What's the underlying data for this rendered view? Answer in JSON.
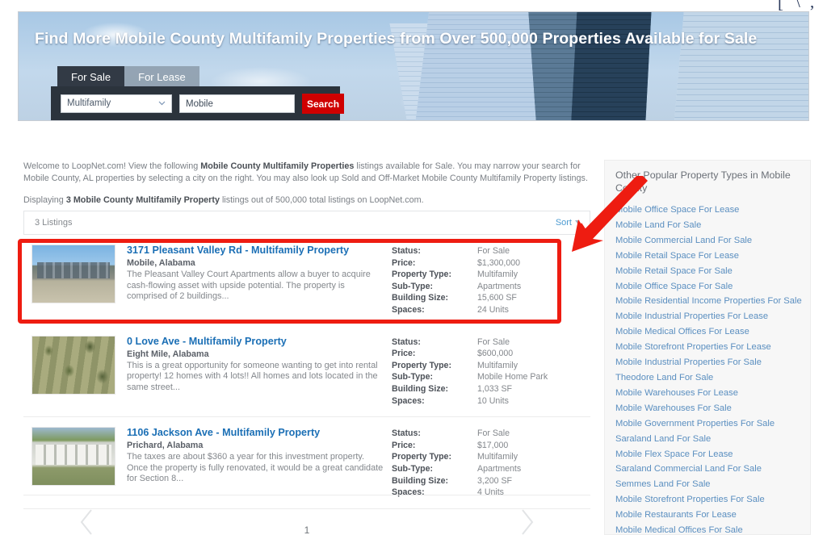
{
  "top_partial_glyphs": [
    "[",
    "\\",
    ",",
    ")"
  ],
  "hero": {
    "title": "Find More Mobile County Multifamily Properties from Over 500,000 Properties Available for Sale",
    "tabs": [
      {
        "label": "For Sale",
        "active": true
      },
      {
        "label": "For Lease",
        "active": false
      }
    ],
    "search": {
      "property_type_value": "Multifamily",
      "location_value": "Mobile",
      "location_placeholder": "Mobile",
      "button_label": "Search",
      "chevron_icon": "chevron-down-icon",
      "accent_color": "#cf0000"
    }
  },
  "intro": {
    "line1_a": "Welcome to LoopNet.com! View the following ",
    "line1_b": "Mobile County Multifamily Properties",
    "line1_c": " listings available for Sale. You may narrow your search for Mobile County, AL properties by selecting a city on the right. You may also look up Sold and Off-Market Mobile County Multifamily Property listings.",
    "line2_a": "Displaying ",
    "line2_b": "3 Mobile County Multifamily Property",
    "line2_c": " listings out of 500,000 total listings on LoopNet.com."
  },
  "listings_header": {
    "count_label": "3 Listings",
    "sort_label": "Sort",
    "sort_icon": "caret-down-icon"
  },
  "spec_labels": [
    "Status:",
    "Price:",
    "Property Type:",
    "Sub-Type:",
    "Building Size:",
    "Spaces:"
  ],
  "listings": [
    {
      "title": "3171 Pleasant Valley Rd - Multifamily Property",
      "city": "Mobile, Alabama",
      "description": "The Pleasant Valley Court Apartments allow a buyer to acquire cash-flowing asset with upside potential. The property is comprised of 2 buildings...",
      "thumb_icon": "apartment-building-photo",
      "specs": {
        "status": "For Sale",
        "price": "$1,300,000",
        "property_type": "Multifamily",
        "sub_type": "Apartments",
        "building_size": "15,600 SF",
        "spaces": "24 Units"
      },
      "highlighted": true
    },
    {
      "title": "0 Love Ave - Multifamily Property",
      "city": "Eight Mile, Alabama",
      "description": "This is a great opportunity for someone wanting to get into rental property! 12 homes with 4 lots!! All homes and lots located in the same street...",
      "thumb_icon": "aerial-lot-photo",
      "specs": {
        "status": "For Sale",
        "price": "$600,000",
        "property_type": "Multifamily",
        "sub_type": "Mobile Home Park",
        "building_size": "1,033 SF",
        "spaces": "10 Units"
      },
      "highlighted": false
    },
    {
      "title": "1106 Jackson Ave - Multifamily Property",
      "city": "Prichard, Alabama",
      "description": "The taxes are about $360 a year for this investment property. Once the property is fully renovated, it would be a great candidate for Section 8...",
      "thumb_icon": "single-story-house-photo",
      "specs": {
        "status": "For Sale",
        "price": "$17,000",
        "property_type": "Multifamily",
        "sub_type": "Apartments",
        "building_size": "3,200 SF",
        "spaces": "4 Units"
      },
      "highlighted": false
    }
  ],
  "pagination": {
    "prev_icon": "chevron-left-icon",
    "next_icon": "chevron-right-icon",
    "current_page": "1"
  },
  "sidebar": {
    "title": "Other Popular Property Types in Mobile County",
    "links": [
      "Mobile Office Space For Lease",
      "Mobile Land For Sale",
      "Mobile Commercial Land For Sale",
      "Mobile Retail Space For Lease",
      "Mobile Retail Space For Sale",
      "Mobile Office Space For Sale",
      "Mobile Residential Income Properties For Sale",
      "Mobile Industrial Properties For Lease",
      "Mobile Medical Offices For Lease",
      "Mobile Storefront Properties For Lease",
      "Mobile Industrial Properties For Sale",
      "Theodore Land For Sale",
      "Mobile Warehouses For Lease",
      "Mobile Warehouses For Sale",
      "Mobile Government Properties For Sale",
      "Saraland Land For Sale",
      "Mobile Flex Space For Lease",
      "Saraland Commercial Land For Sale",
      "Semmes Land For Sale",
      "Mobile Storefront Properties For Sale",
      "Mobile Restaurants For Lease",
      "Mobile Medical Offices For Sale"
    ]
  },
  "annotations": {
    "highlight_color": "#ee1c11",
    "arrow_icon": "red-arrow-pointing-down-left",
    "box_icon": "red-highlight-rectangle"
  }
}
